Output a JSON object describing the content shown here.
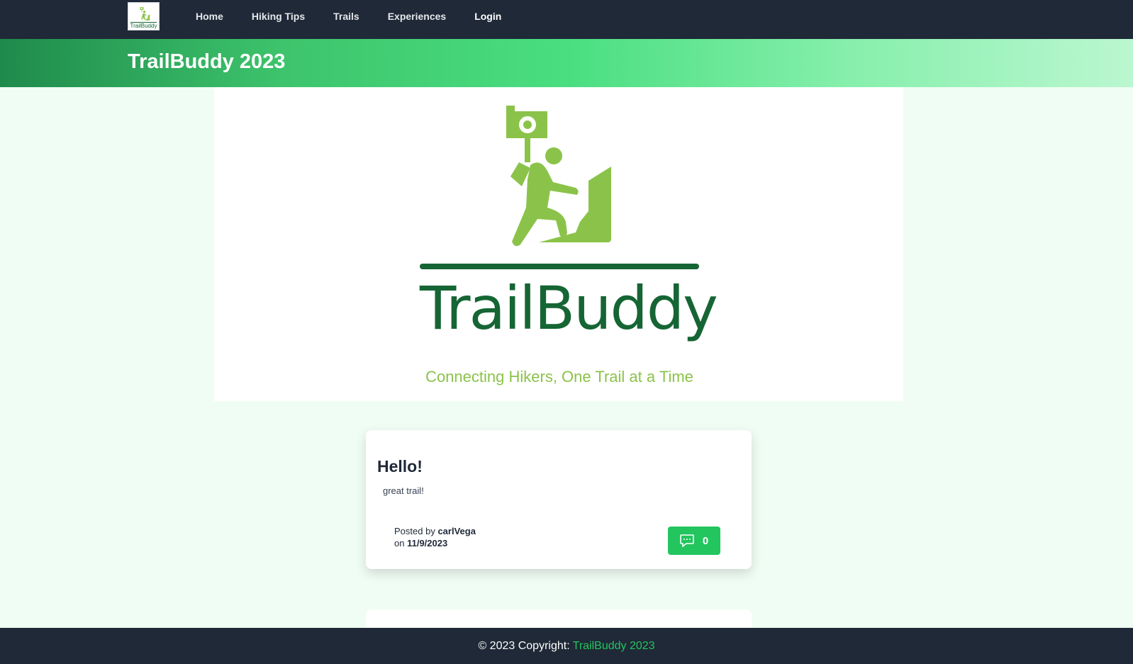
{
  "navbar": {
    "logo_text": "TrailBuddy",
    "links": [
      {
        "label": "Home"
      },
      {
        "label": "Hiking Tips"
      },
      {
        "label": "Trails"
      },
      {
        "label": "Experiences"
      },
      {
        "label": "Login"
      }
    ]
  },
  "hero": {
    "title": "TrailBuddy 2023"
  },
  "banner": {
    "name": "TrailBuddy",
    "tagline": "Connecting Hikers, One Trail at a Time",
    "colors": {
      "primary": "#166534",
      "accent": "#8bc34a"
    }
  },
  "posts": [
    {
      "title": "Hello!",
      "body": "great trail!",
      "posted_by_prefix": "Posted by",
      "author": "carlVega",
      "on_prefix": "on",
      "date": "11/9/2023",
      "comment_icon": "chat-bubble-icon",
      "comment_count": "0"
    }
  ],
  "footer": {
    "copyright": "© 2023 Copyright:",
    "brand": "TrailBuddy 2023"
  }
}
